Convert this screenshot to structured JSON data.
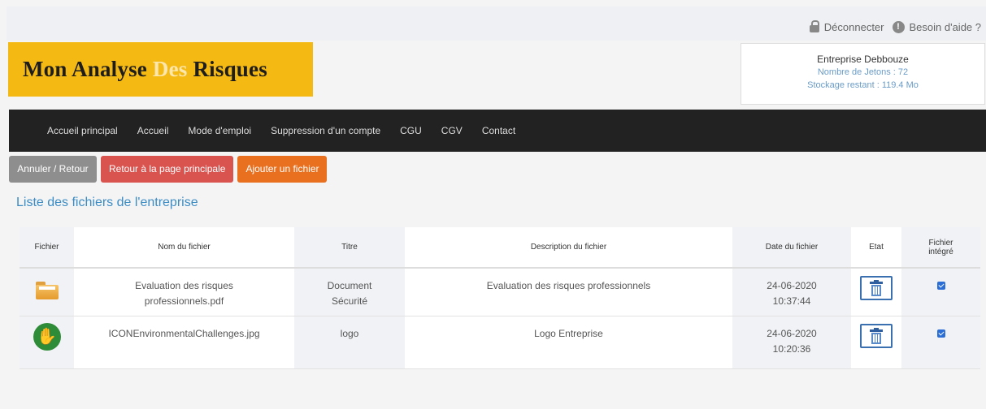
{
  "header": {
    "logout_label": "Déconnecter",
    "help_label": "Besoin d'aide ?",
    "logo": {
      "part1": "Mon Analyse ",
      "part2": "Des",
      "part3": " Risques"
    },
    "company": {
      "name": "Entreprise Debbouze",
      "tokens": "Nombre de Jetons : 72",
      "storage": "Stockage restant : 119.4 Mo"
    }
  },
  "nav": {
    "items": [
      "Accueil principal",
      "Accueil",
      "Mode d'emploi",
      "Suppression d'un compte",
      "CGU",
      "CGV",
      "Contact"
    ]
  },
  "actions": {
    "cancel": "Annuler / Retour",
    "back_main": "Retour à la page principale",
    "add_file": "Ajouter un fichier"
  },
  "list_title": "Liste des fichiers de l'entreprise",
  "table": {
    "headers": [
      "Fichier",
      "Nom du fichier",
      "Titre",
      "Description du fichier",
      "Date du fichier",
      "Etat",
      "Fichier intégré"
    ],
    "rows": [
      {
        "icon": "folder-icon",
        "name_l1": "Evaluation des risques",
        "name_l2": "professionnels.pdf",
        "title_l1": "Document",
        "title_l2": "Sécurité",
        "description": "Evaluation des risques professionnels",
        "date": "24-06-2020",
        "time": "10:37:44",
        "integrated": true
      },
      {
        "icon": "environment-hand-icon",
        "name_l1": "ICONEnvironmentalChallenges.jpg",
        "name_l2": "",
        "title_l1": "logo",
        "title_l2": "",
        "description": "Logo Entreprise",
        "date": "24-06-2020",
        "time": "10:20:36",
        "integrated": true
      }
    ]
  },
  "colors": {
    "logo_bg": "#f5b914",
    "nav_bg": "#222222",
    "btn_grey": "#8e8e8e",
    "btn_red": "#d9534f",
    "btn_orange": "#e8701f",
    "link_blue": "#3c8cc4"
  }
}
